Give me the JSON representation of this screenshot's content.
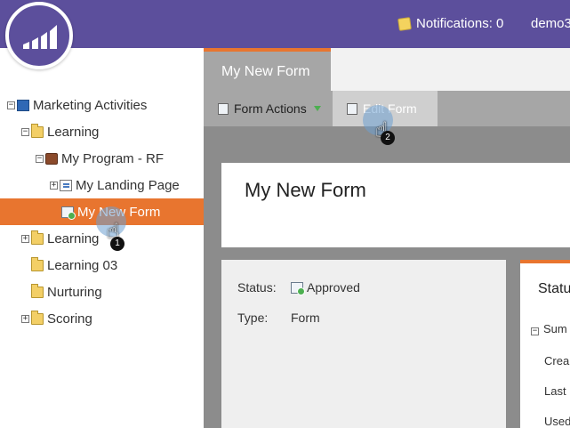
{
  "header": {
    "notifications_label": "Notifications: 0",
    "user_label": "demo3"
  },
  "sidebar": {
    "items": [
      {
        "label": "Marketing Activities",
        "expander": "−",
        "icon": "book-icon"
      },
      {
        "label": "Learning",
        "expander": "−",
        "icon": "folder-icon"
      },
      {
        "label": "My Program - RF",
        "expander": "−",
        "icon": "program-icon"
      },
      {
        "label": "My Landing Page",
        "expander": "+",
        "icon": "landing-page-icon"
      },
      {
        "label": "My New Form",
        "expander": "",
        "icon": "form-icon",
        "selected": true
      },
      {
        "label": "Learning",
        "expander": "+",
        "icon": "folder-icon"
      },
      {
        "label": "Learning 03",
        "expander": "",
        "icon": "folder-icon"
      },
      {
        "label": "Nurturing",
        "expander": "",
        "icon": "folder-icon"
      },
      {
        "label": "Scoring",
        "expander": "+",
        "icon": "folder-icon"
      }
    ]
  },
  "main": {
    "tab_label": "My New Form",
    "toolbar": {
      "form_actions_label": "Form Actions",
      "edit_form_label": "Edit Form"
    },
    "title": "My New Form",
    "details": {
      "status_label": "Status:",
      "status_value": "Approved",
      "type_label": "Type:",
      "type_value": "Form"
    },
    "right_panel": {
      "header": "Status",
      "summary_label": "Sum",
      "created_label": "Crea",
      "last_label": "Last",
      "used_label": "Used"
    }
  },
  "callouts": {
    "step1": "1",
    "step2": "2"
  },
  "colors": {
    "brand_purple": "#5c4f9c",
    "accent_orange": "#e8752f"
  }
}
